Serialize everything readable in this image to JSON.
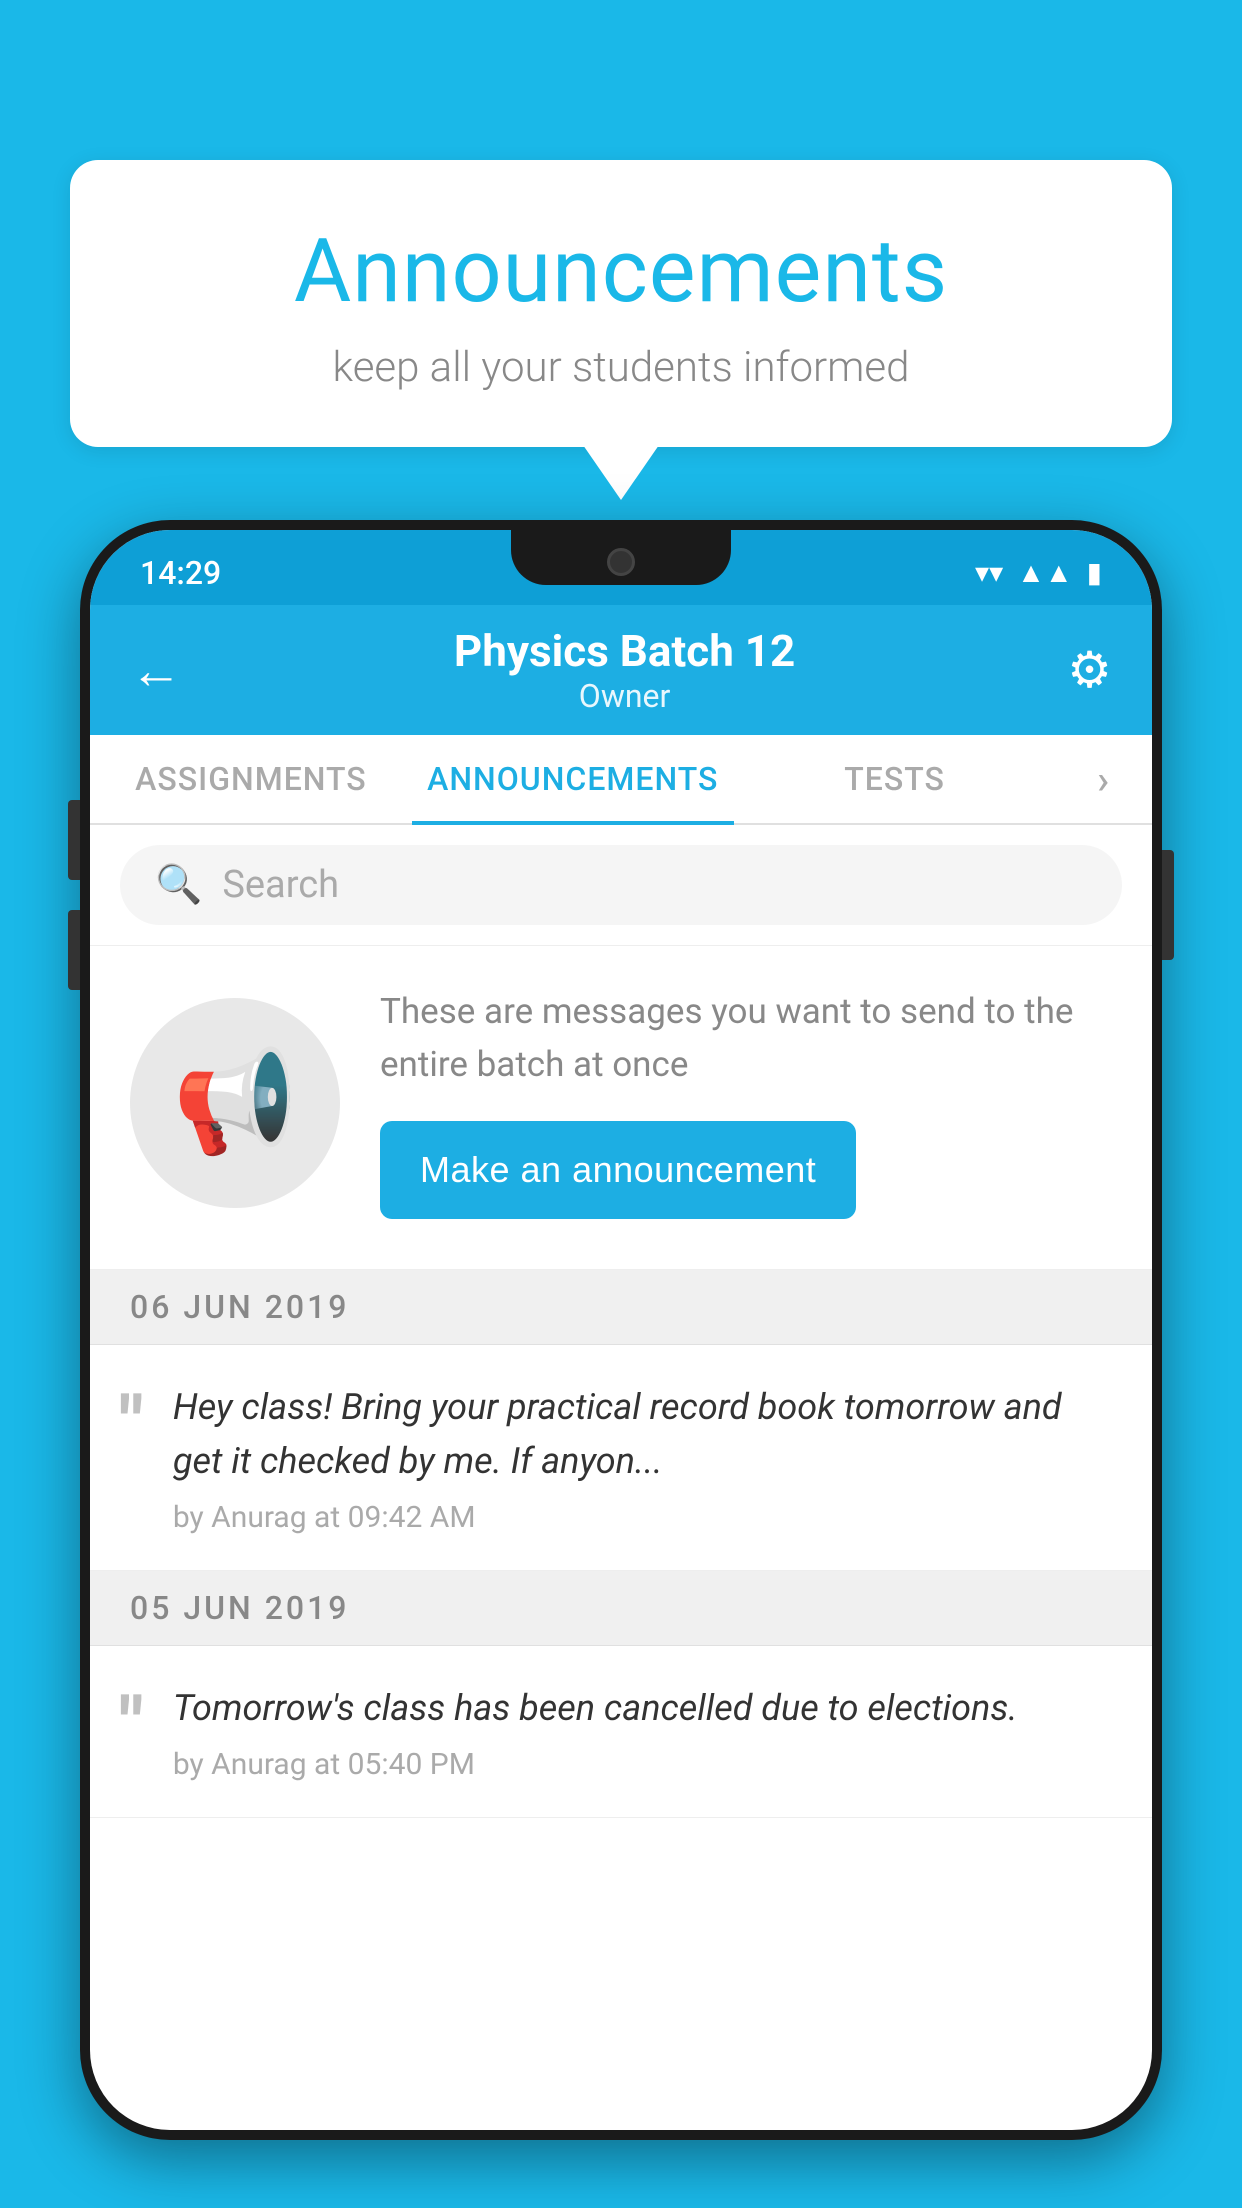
{
  "background_color": "#1ab8e8",
  "speech_bubble": {
    "title": "Announcements",
    "subtitle": "keep all your students informed"
  },
  "phone": {
    "status_bar": {
      "time": "14:29",
      "icons": [
        "wifi",
        "signal",
        "battery"
      ]
    },
    "header": {
      "title": "Physics Batch 12",
      "subtitle": "Owner",
      "back_label": "←",
      "gear_label": "⚙"
    },
    "tabs": [
      {
        "label": "ASSIGNMENTS",
        "active": false
      },
      {
        "label": "ANNOUNCEMENTS",
        "active": true
      },
      {
        "label": "TESTS",
        "active": false
      },
      {
        "label": "···",
        "active": false
      }
    ],
    "search": {
      "placeholder": "Search"
    },
    "announcement_prompt": {
      "description": "These are messages you want to send to the entire batch at once",
      "button_label": "Make an announcement"
    },
    "announcements": [
      {
        "date": "06  JUN  2019",
        "items": [
          {
            "text": "Hey class! Bring your practical record book tomorrow and get it checked by me. If anyon...",
            "author": "by Anurag at 09:42 AM"
          }
        ]
      },
      {
        "date": "05  JUN  2019",
        "items": [
          {
            "text": "Tomorrow's class has been cancelled due to elections.",
            "author": "by Anurag at 05:40 PM"
          }
        ]
      }
    ]
  }
}
